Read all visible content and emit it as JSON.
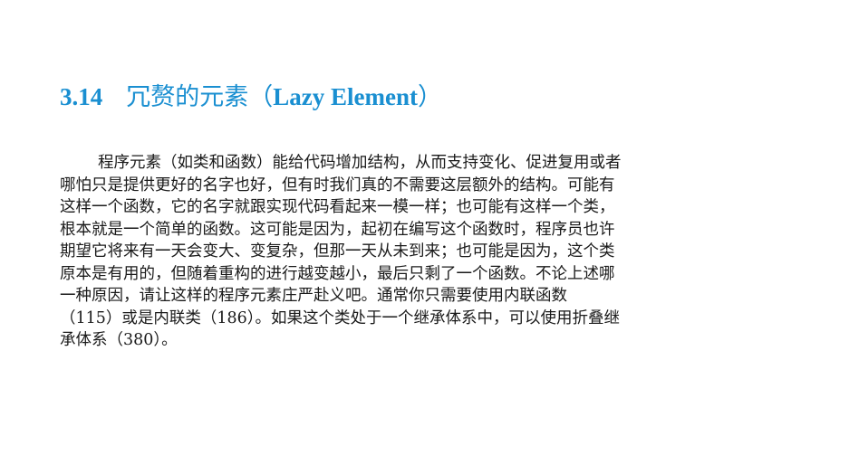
{
  "section": {
    "number": "3.14",
    "title_cn_prefix": "冗赘的元素（",
    "title_latin": "Lazy Element",
    "title_cn_suffix": "）"
  },
  "paragraph": {
    "lines": [
      "程序元素（如类和函数）能给代码增加结构，从而支持变化、促进复用或者",
      "哪怕只是提供更好的名字也好，但有时我们真的不需要这层额外的结构。可能有",
      "这样一个函数，它的名字就跟实现代码看起来一模一样；也可能有这样一个类，",
      "根本就是一个简单的函数。这可能是因为，起初在编写这个函数时，程序员也许",
      "期望它将来有一天会变大、变复杂，但那一天从未到来；也可能是因为，这个类",
      "原本是有用的，但随着重构的进行越变越小，最后只剩了一个函数。不论上述哪",
      "一种原因，请让这样的程序元素庄严赴义吧。通常你只需要使用内联函数",
      "（115）或是内联类（186）。如果这个类处于一个继承体系中，可以使用折叠继",
      "承体系（380）。"
    ]
  },
  "colors": {
    "heading": "#1a8fd1",
    "body_text": "#1a1a1a",
    "background": "#ffffff"
  }
}
